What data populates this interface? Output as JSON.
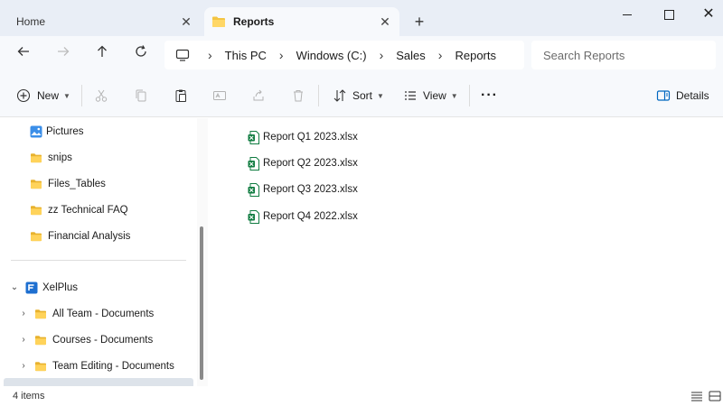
{
  "tabs": [
    {
      "label": "Home",
      "active": false
    },
    {
      "label": "Reports",
      "active": true
    }
  ],
  "titlebar": {
    "new_tab": "+",
    "close": "✕"
  },
  "address": {
    "crumbs": [
      "This PC",
      "Windows (C:)",
      "Sales",
      "Reports"
    ],
    "separator": "›"
  },
  "search": {
    "placeholder": "Search Reports"
  },
  "commands": {
    "new": "New",
    "sort": "Sort",
    "view": "View",
    "more": "···",
    "details": "Details"
  },
  "sidebar": {
    "quick_access": [
      {
        "label": "Pictures",
        "icon": "pictures-icon",
        "pinned": true
      },
      {
        "label": "snips",
        "icon": "folder-icon"
      },
      {
        "label": "Files_Tables",
        "icon": "folder-icon"
      },
      {
        "label": "zz Technical FAQ",
        "icon": "folder-icon"
      },
      {
        "label": "Financial Analysis",
        "icon": "folder-icon"
      }
    ],
    "onedrive": {
      "label": "XelPlus",
      "icon": "onedrive-business-icon",
      "expanded": true,
      "children": [
        {
          "label": "All Team - Documents"
        },
        {
          "label": "Courses - Documents"
        },
        {
          "label": "Team Editing - Documents"
        }
      ]
    }
  },
  "files": [
    {
      "name": "Report Q1 2023.xlsx",
      "icon": "excel-file-icon"
    },
    {
      "name": "Report Q2 2023.xlsx",
      "icon": "excel-file-icon"
    },
    {
      "name": "Report Q3 2023.xlsx",
      "icon": "excel-file-icon"
    },
    {
      "name": "Report Q4 2022.xlsx",
      "icon": "excel-file-icon"
    }
  ],
  "status": {
    "item_count": "4 items"
  },
  "colors": {
    "folder": "#f4c542",
    "excel": "#107c41",
    "accent": "#0067c0"
  }
}
